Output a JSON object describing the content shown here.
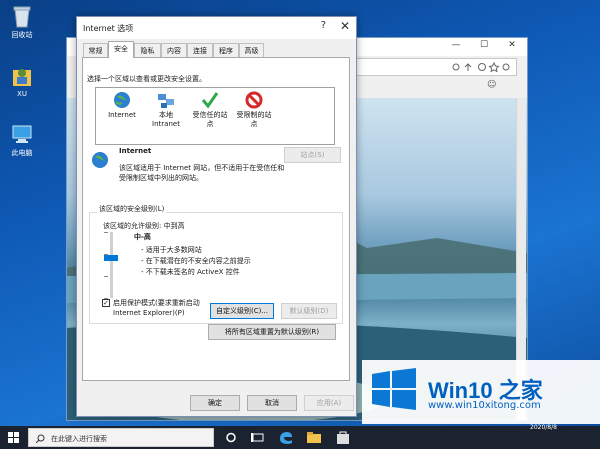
{
  "desktop": {
    "icons": [
      {
        "label": "回收站"
      },
      {
        "label": "XU"
      },
      {
        "label": "此电脑"
      }
    ]
  },
  "dialog": {
    "title": "Internet 选项",
    "help": "?",
    "close": "✕",
    "tabs": [
      {
        "label": "常规"
      },
      {
        "label": "安全"
      },
      {
        "label": "隐私"
      },
      {
        "label": "内容"
      },
      {
        "label": "连接"
      },
      {
        "label": "程序"
      },
      {
        "label": "高级"
      }
    ],
    "zone_prompt": "选择一个区域以查看或更改安全设置。",
    "zones": [
      {
        "label": "Internet",
        "icon": "globe-icon"
      },
      {
        "label": "本地\nIntranet",
        "icon": "network-icon"
      },
      {
        "label": "受信任的站\n点",
        "icon": "checkmark-icon"
      },
      {
        "label": "受限制的站\n点",
        "icon": "no-entry-icon"
      }
    ],
    "selected_zone": {
      "name": "Internet",
      "description": "该区域适用于 Internet 网站，但不适用于在受信任和受限制区域中列出的网站。",
      "sites_button": "站点(S)"
    },
    "security_level": {
      "legend": "该区域的安全级别(L)",
      "allowed_levels": "该区域的允许级别: 中到高",
      "level_name": "中-高",
      "bullets": [
        "- 适用于大多数网站",
        "- 在下载潜在的不安全内容之前提示",
        "- 不下载未签名的 ActiveX 控件"
      ],
      "protected_mode_label": "启用保护模式(要求重新启动\nInternet Explorer)(P)",
      "protected_mode_checked": true,
      "custom_button": "自定义级别(C)...",
      "default_button": "默认级别(D)",
      "reset_all_button": "将所有区域重置为默认级别(R)"
    },
    "footer": {
      "ok": "确定",
      "cancel": "取消",
      "apply": "应用(A)"
    }
  },
  "ie_window": {
    "minimize": "—",
    "maximize": "☐",
    "close": "✕"
  },
  "taskbar": {
    "search_placeholder": "在此键入进行搜索"
  },
  "watermark": {
    "title": "Win10 之家",
    "url": "www.win10xitong.com",
    "date": "2020/8/8"
  },
  "colors": {
    "accent": "#0078d7",
    "watermark_blue": "#0060c0"
  }
}
